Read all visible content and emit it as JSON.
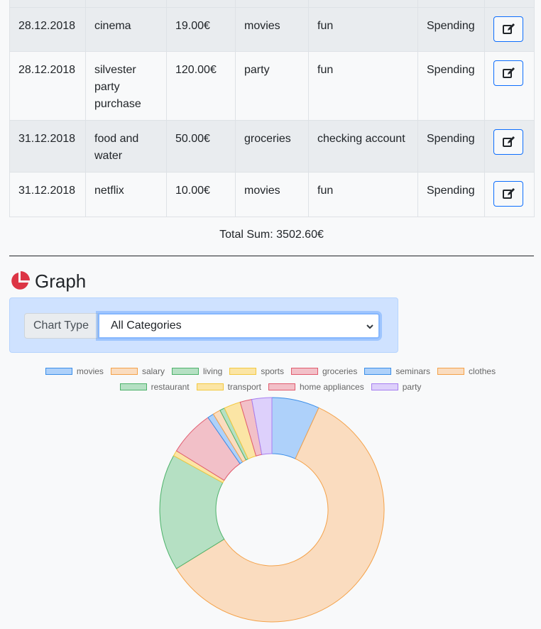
{
  "table": {
    "rows": [
      {
        "date": "28.12.2018",
        "name": "cinema",
        "amount": "19.00€",
        "category": "movies",
        "account": "fun",
        "type": "Spending"
      },
      {
        "date": "28.12.2018",
        "name": "silvester party purchase",
        "amount": "120.00€",
        "category": "party",
        "account": "fun",
        "type": "Spending"
      },
      {
        "date": "31.12.2018",
        "name": "food and water",
        "amount": "50.00€",
        "category": "groceries",
        "account": "checking account",
        "type": "Spending"
      },
      {
        "date": "31.12.2018",
        "name": "netflix",
        "amount": "10.00€",
        "category": "movies",
        "account": "fun",
        "type": "Spending"
      }
    ],
    "edit_icon": "edit-icon"
  },
  "total": "Total Sum: 3502.60€",
  "graph": {
    "title": "Graph",
    "icon": "pie-chart-icon",
    "chart_type_label": "Chart Type",
    "chart_type_value": "All Categories"
  },
  "chart_data": {
    "type": "pie",
    "legend_position": "top",
    "series": [
      {
        "name": "movies",
        "value": 6.9,
        "fill": "#aed1fa",
        "stroke": "#3b8ee8"
      },
      {
        "name": "salary",
        "value": 59.7,
        "fill": "#fadcbf",
        "stroke": "#f4a24a"
      },
      {
        "name": "living",
        "value": 16.9,
        "fill": "#b5e0c3",
        "stroke": "#4db26a"
      },
      {
        "name": "sports",
        "value": 0.8,
        "fill": "#fbe5a5",
        "stroke": "#f3c940"
      },
      {
        "name": "groceries",
        "value": 6.6,
        "fill": "#f2c0c8",
        "stroke": "#e15b6e"
      },
      {
        "name": "seminars",
        "value": 0.9,
        "fill": "#aed1fa",
        "stroke": "#3b8ee8"
      },
      {
        "name": "clothes",
        "value": 1.1,
        "fill": "#fadcbf",
        "stroke": "#f4a24a"
      },
      {
        "name": "restaurant",
        "value": 0.7,
        "fill": "#b5e0c3",
        "stroke": "#4db26a"
      },
      {
        "name": "transport",
        "value": 2.4,
        "fill": "#fbe5a5",
        "stroke": "#f3c940"
      },
      {
        "name": "home appliances",
        "value": 1.7,
        "fill": "#f2c0c8",
        "stroke": "#e15b6e"
      },
      {
        "name": "party",
        "value": 2.9,
        "fill": "#ddd0fb",
        "stroke": "#a77ef0"
      }
    ]
  }
}
